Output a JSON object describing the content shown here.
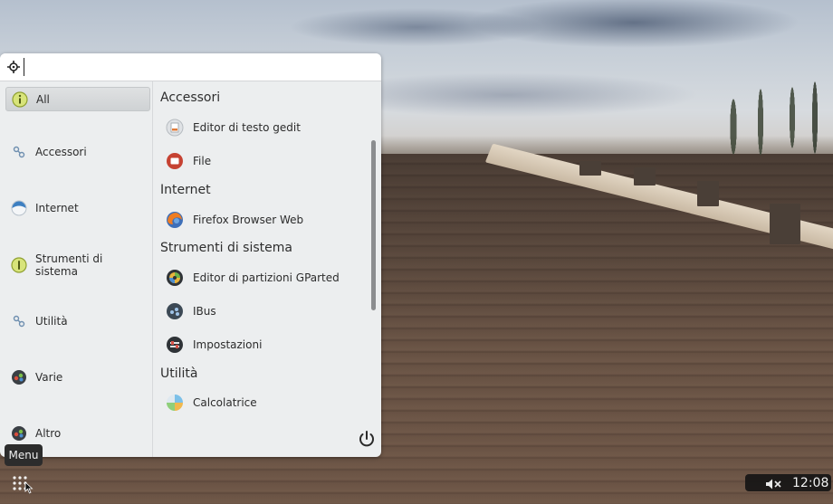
{
  "search": {
    "value": "",
    "placeholder": ""
  },
  "categories": [
    {
      "label": "All",
      "icon": "info-circle-icon",
      "active": true
    },
    {
      "label": "Accessori",
      "icon": "accessories-icon",
      "active": false
    },
    {
      "label": "Internet",
      "icon": "globe-icon",
      "active": false
    },
    {
      "label": "Strumenti di sistema",
      "icon": "system-tools-icon",
      "active": false
    },
    {
      "label": "Utilità",
      "icon": "utilities-icon",
      "active": false
    },
    {
      "label": "Varie",
      "icon": "misc-icon",
      "active": false
    },
    {
      "label": "Altro",
      "icon": "other-icon",
      "active": false
    }
  ],
  "sections": [
    {
      "title": "Accessori",
      "apps": [
        {
          "label": "Editor di testo gedit",
          "icon": "gedit-icon"
        },
        {
          "label": "File",
          "icon": "files-icon"
        }
      ]
    },
    {
      "title": "Internet",
      "apps": [
        {
          "label": "Firefox Browser Web",
          "icon": "firefox-icon"
        }
      ]
    },
    {
      "title": "Strumenti di sistema",
      "apps": [
        {
          "label": "Editor di partizioni GParted",
          "icon": "gparted-icon"
        },
        {
          "label": "IBus",
          "icon": "ibus-icon"
        },
        {
          "label": "Impostazioni",
          "icon": "settings-icon"
        }
      ]
    },
    {
      "title": "Utilità",
      "apps": [
        {
          "label": "Calcolatrice",
          "icon": "calculator-icon"
        }
      ]
    }
  ],
  "tooltip": {
    "text": "Menu"
  },
  "tray": {
    "clock": "12:08",
    "volume_icon": "volume-muted-icon"
  },
  "colors": {
    "panel_bg": "#eceeef",
    "active_category": "#d4d7d9",
    "tray_bg": "#141414"
  }
}
